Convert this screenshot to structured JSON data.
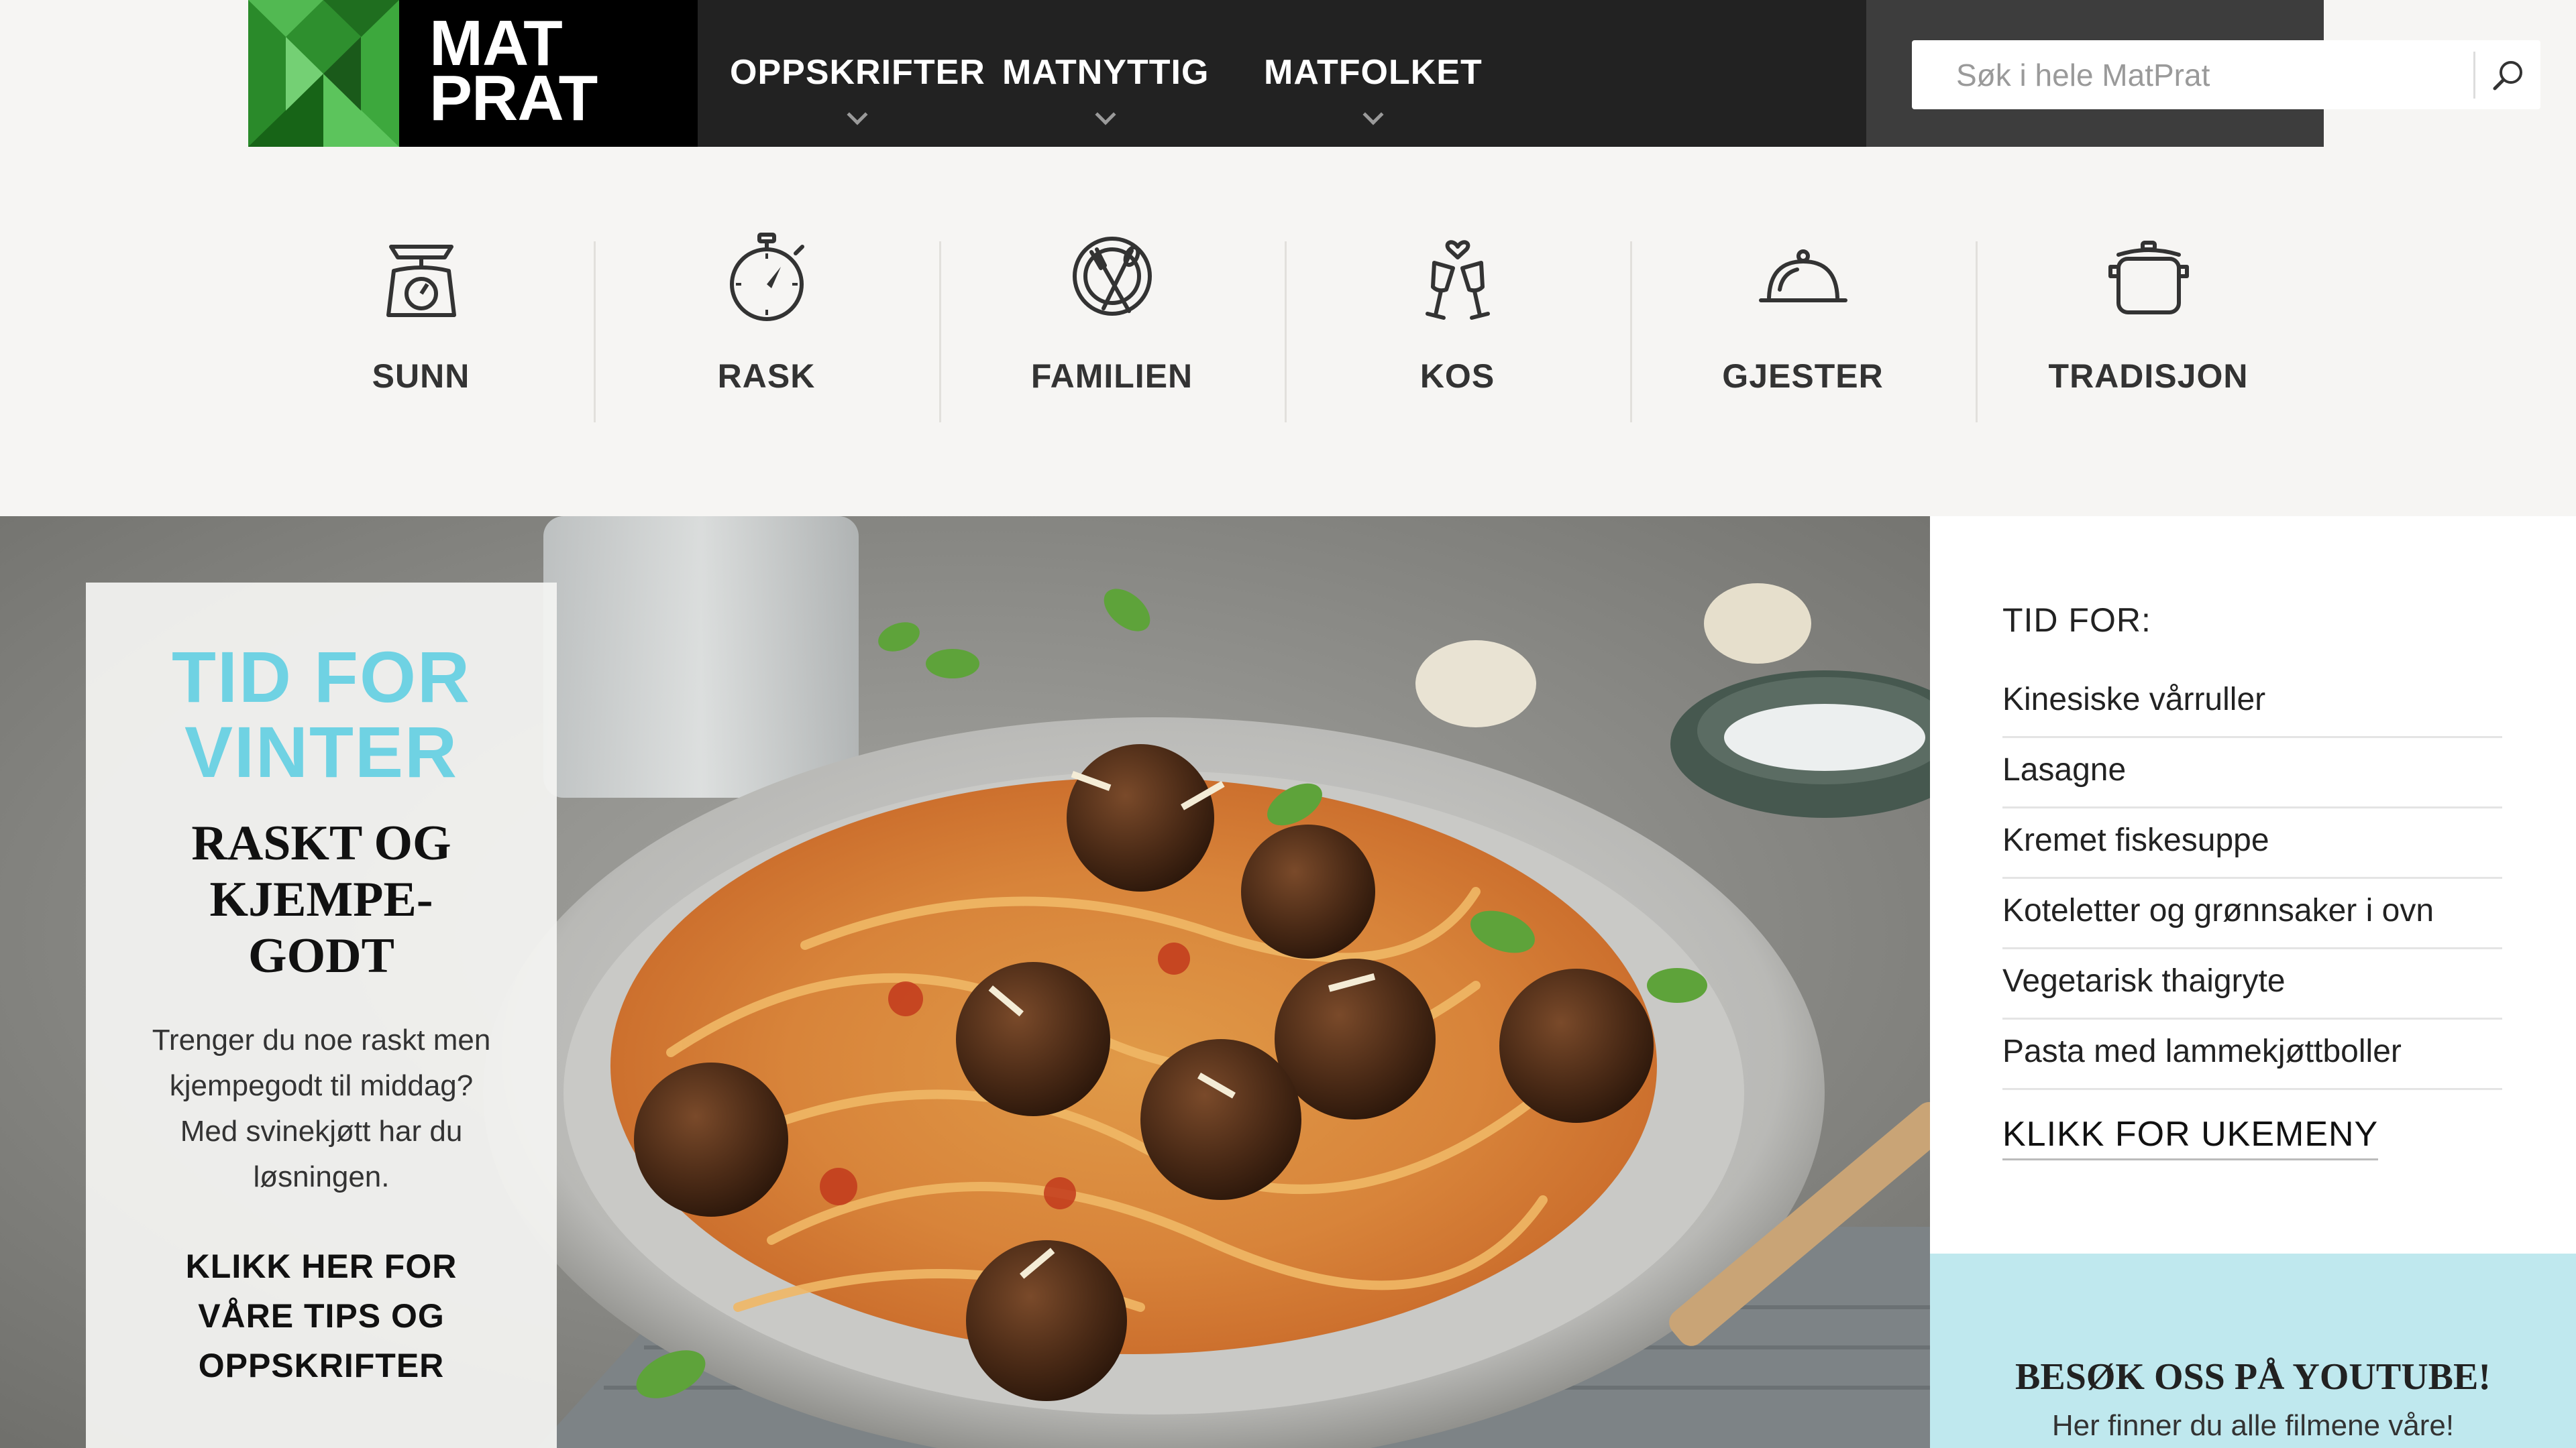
{
  "logo": {
    "line1": "MAT",
    "line2": "PRAT"
  },
  "nav": {
    "items": [
      {
        "label": "OPPSKRIFTER"
      },
      {
        "label": "MATNYTTIG"
      },
      {
        "label": "MATFOLKET"
      }
    ]
  },
  "search": {
    "placeholder": "Søk i hele MatPrat",
    "icon": "search-icon"
  },
  "categories": [
    {
      "label": "SUNN",
      "icon": "kitchen-scale-icon"
    },
    {
      "label": "RASK",
      "icon": "stopwatch-icon"
    },
    {
      "label": "FAMILIEN",
      "icon": "plate-cutlery-icon"
    },
    {
      "label": "KOS",
      "icon": "wine-glasses-heart-icon"
    },
    {
      "label": "GJESTER",
      "icon": "cloche-icon"
    },
    {
      "label": "TRADISJON",
      "icon": "cooking-pot-icon"
    }
  ],
  "promo": {
    "kicker_line1": "TID FOR",
    "kicker_line2": "VINTER",
    "title_line1": "RASKT OG",
    "title_line2": "KJEMPE-",
    "title_line3": "GODT",
    "body": "Trenger du noe raskt men kjempegodt til middag? Med svinekjøtt har du løsningen.",
    "link": "KLIKK HER FOR VÅRE TIPS OG OPPSKRIFTER"
  },
  "sidebar": {
    "heading": "TID FOR:",
    "recipes": [
      "Kinesiske vårruller",
      "Lasagne",
      "Kremet fiskesuppe",
      "Koteletter og grønnsaker i ovn",
      "Vegetarisk thaigryte",
      "Pasta med lammekjøttboller"
    ],
    "cta": "KLIKK FOR UKEMENY"
  },
  "youtube": {
    "title": "BESØK OSS PÅ YOUTUBE!",
    "subtitle": "Her finner du alle filmene våre!"
  },
  "colors": {
    "accent_cyan": "#6fd2e3",
    "logo_green": "#3a9a3a",
    "header_dark": "#222222",
    "youtube_bg": "#bfe8ee"
  }
}
